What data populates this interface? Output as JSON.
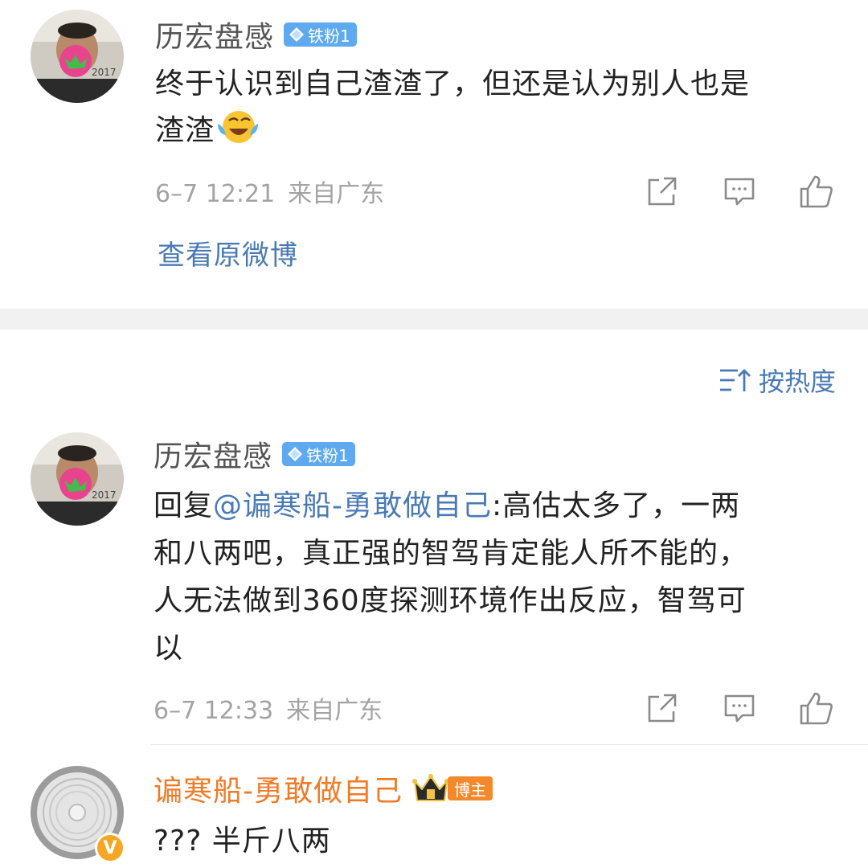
{
  "comment1": {
    "username": "历宏盘感",
    "fan_badge": "铁粉1",
    "text_line1": "终于认识到自己渣渣了，但还是认为别人也是",
    "text_line2": "渣渣",
    "emoji": "laughing-crying-emoji",
    "time": "6–7 12:21",
    "location": "来自广东",
    "view_original": "查看原微博"
  },
  "sort": {
    "label": "按热度"
  },
  "comment2": {
    "username": "历宏盘感",
    "fan_badge": "铁粉1",
    "reply_prefix": "回复",
    "mention": "@谝寒船-勇敢做自己",
    "line1_rest": ":高估太多了，一两",
    "line2": "和八两吧，真正强的智驾肯定能人所不能的，",
    "line3": "人无法做到360度探测环境作出反应，智驾可",
    "line4": "以",
    "time": "6–7 12:33",
    "location": "来自广东"
  },
  "comment3": {
    "username": "谝寒船-勇敢做自己",
    "host_badge": "博主",
    "verified_badge": "V",
    "text": "??? 半斤八两"
  },
  "colors": {
    "link_blue": "#4a7ab5",
    "meta_gray": "#a3a3a3",
    "host_orange": "#f07b27",
    "fan_badge_blue": "#5ea9ef"
  }
}
